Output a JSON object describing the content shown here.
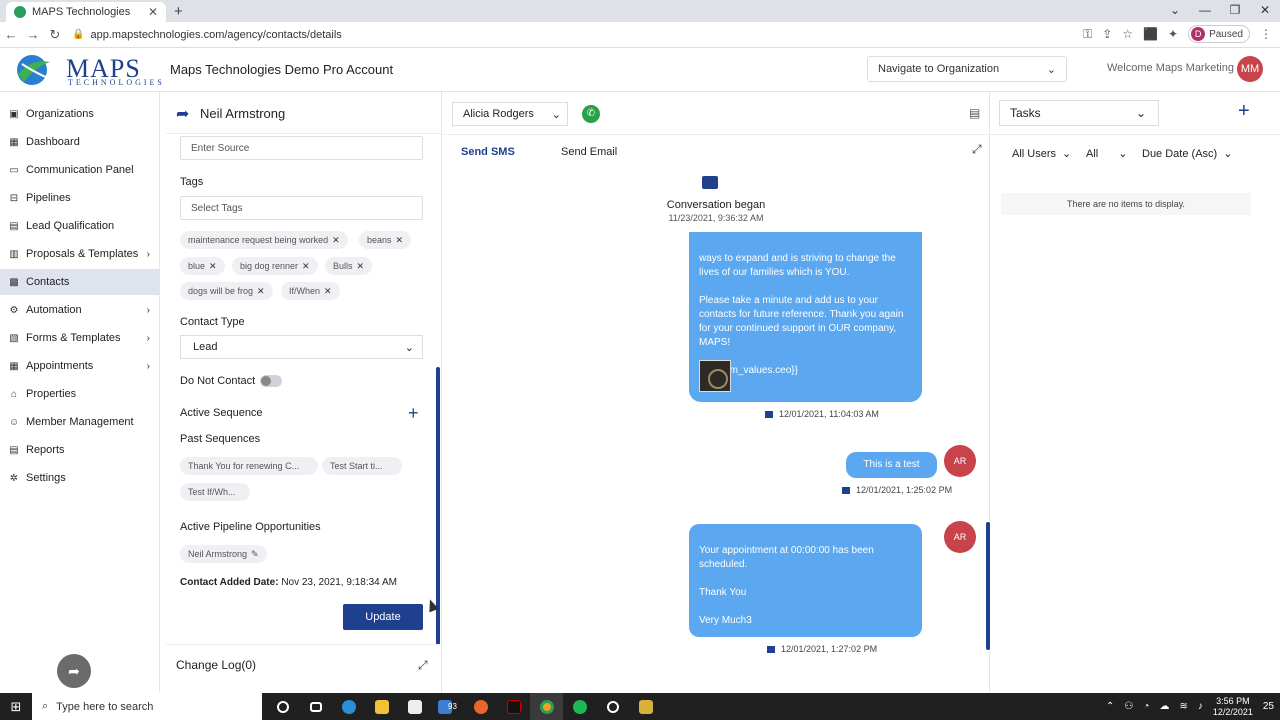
{
  "browser": {
    "tab_title": "MAPS Technologies",
    "url": "app.mapstechnologies.com/agency/contacts/details",
    "profile_initial": "D",
    "profile_status": "Paused"
  },
  "header": {
    "logo_main": "MAPS",
    "logo_sub": "TECHNOLOGIES",
    "account_title": "Maps Technologies Demo Pro Account",
    "navigate_placeholder": "Navigate to Organization",
    "welcome": "Welcome Maps Marketing",
    "user_initials": "MM"
  },
  "sidebar": {
    "items": [
      {
        "label": "Organizations",
        "icon": "building-icon"
      },
      {
        "label": "Dashboard",
        "icon": "dashboard-icon"
      },
      {
        "label": "Communication Panel",
        "icon": "chat-icon"
      },
      {
        "label": "Pipelines",
        "icon": "funnel-icon"
      },
      {
        "label": "Lead Qualification",
        "icon": "clipboard-icon"
      },
      {
        "label": "Proposals & Templates",
        "icon": "document-icon"
      },
      {
        "label": "Contacts",
        "icon": "contacts-icon"
      },
      {
        "label": "Automation",
        "icon": "gear-icon"
      },
      {
        "label": "Forms & Templates",
        "icon": "form-icon"
      },
      {
        "label": "Appointments",
        "icon": "calendar-icon"
      },
      {
        "label": "Properties",
        "icon": "home-icon"
      },
      {
        "label": "Member Management",
        "icon": "users-icon"
      },
      {
        "label": "Reports",
        "icon": "report-icon"
      },
      {
        "label": "Settings",
        "icon": "settings-icon"
      }
    ]
  },
  "details": {
    "contact_name": "Neil Armstrong",
    "source_placeholder": "Enter Source",
    "tags_label": "Tags",
    "tags_placeholder": "Select Tags",
    "tags": [
      "maintenance request being worked",
      "beans",
      "blue",
      "big dog renner",
      "Bulls",
      "dogs will be frog",
      "If/When"
    ],
    "contact_type_label": "Contact Type",
    "contact_type_value": "Lead",
    "do_not_contact_label": "Do Not Contact",
    "active_sequence_label": "Active Sequence",
    "past_sequences_label": "Past Sequences",
    "past_sequences": [
      "Thank You for renewing C...",
      "Test Start ti...",
      "Test If/Wh..."
    ],
    "pipeline_label": "Active Pipeline Opportunities",
    "pipeline_opportunity": "Neil Armstrong",
    "added_date_label": "Contact Added Date:",
    "added_date_value": "Nov 23, 2021, 9:18:34 AM",
    "update_label": "Update",
    "change_log_label": "Change Log(0)"
  },
  "conversation": {
    "agent": "Alicia Rodgers",
    "tab_sms": "Send SMS",
    "tab_email": "Send Email",
    "began_text": "Conversation began",
    "began_time": "11/23/2021, 9:36:32 AM",
    "msg1_text": "ways to expand and is striving to change the lives of our families which is YOU.\n\nPlease take a minute and add us to your contacts for future reference.  Thank you again for your continued support in OUR company, MAPS!\n\n{{custom_values.ceo}}",
    "msg1_time": "12/01/2021, 11:04:03 AM",
    "msg2_text": "This is a test",
    "msg2_time": "12/01/2021, 1:25:02 PM",
    "msg3_text": "Your appointment at 00:00:00 has been scheduled.\n\nThank You\n\nVery Much3",
    "msg3_time": "12/01/2021, 1:27:02 PM",
    "sender_initials": "AR"
  },
  "tasks": {
    "title": "Tasks",
    "filter_users": "All Users",
    "filter_status": "All",
    "filter_sort": "Due Date (Asc)",
    "empty_text": "There are no items to display."
  },
  "taskbar": {
    "search_placeholder": "Type here to search",
    "mail_badge": "93",
    "time": "3:56 PM",
    "date": "12/2/2021",
    "notifications": "25"
  },
  "colors": {
    "brand": "#1f3f8f",
    "bubble": "#5ba8f0",
    "avatar": "#c9444a",
    "call": "#2aa048"
  }
}
